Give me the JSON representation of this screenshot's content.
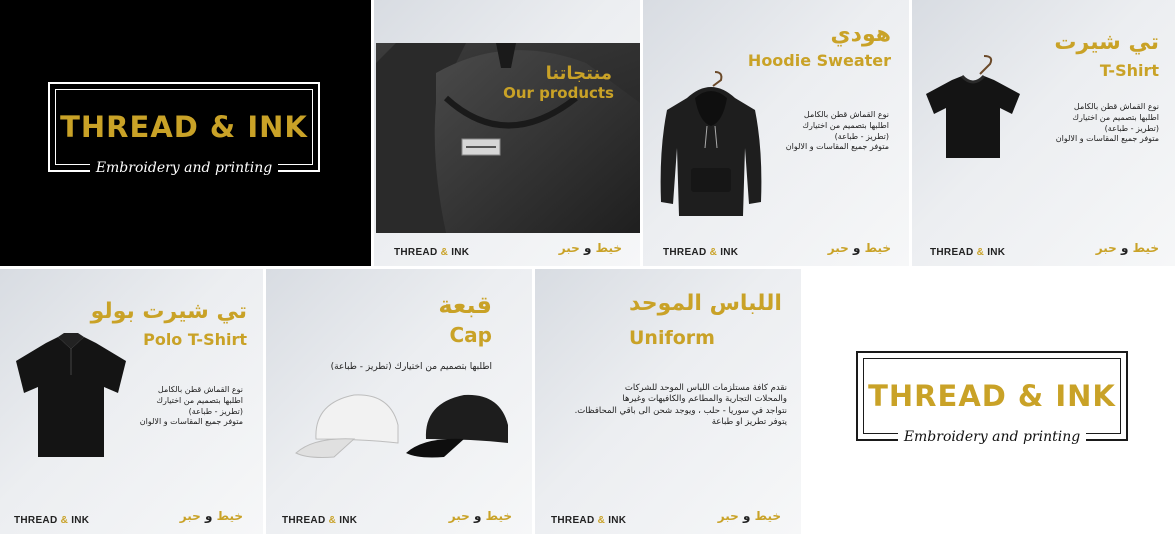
{
  "brand": {
    "name": "THREAD & INK",
    "tagline": "Embroidery and printing",
    "footer_en_left": "THREAD",
    "footer_en_amp": "&",
    "footer_en_right": "INK",
    "footer_ar_left": "خيط",
    "footer_ar_mid": "و",
    "footer_ar_right": "حبر"
  },
  "colors": {
    "gold": "#c9a227",
    "dark": "#000000",
    "tile_bg": "#e6e8eb"
  },
  "tiles": {
    "products": {
      "title_ar": "منتجاتنا",
      "title_en": "Our products",
      "tag_text": "THREAD & INK"
    },
    "hoodie": {
      "title_ar": "هودي",
      "title_en": "Hoodie Sweater",
      "lines": [
        "نوع القماش قطن بالكامل",
        "اطلبها بتصميم من اختيارك",
        "(تطريز - طباعة)",
        "متوفر جميع المقاسات و الالوان"
      ]
    },
    "tshirt": {
      "title_ar": "تي شيرت",
      "title_en": "T-Shirt",
      "lines": [
        "نوع القماش قطن بالكامل",
        "اطلبها بتصميم من اختيارك",
        "(تطريز - طباعة)",
        "متوفر جميع المقاسات و الالوان"
      ]
    },
    "polo": {
      "title_ar": "تي شيرت بولو",
      "title_en": "Polo T-Shirt",
      "lines": [
        "نوع القماش قطن بالكامل",
        "اطلبها بتصميم من اختيارك",
        "(تطريز - طباعة)",
        "متوفر جميع المقاسات و الالوان"
      ]
    },
    "cap": {
      "title_ar": "قبعة",
      "title_en": "Cap",
      "lines": [
        "اطلبها بتصميم من اختيارك (تطريز - طباعة)"
      ]
    },
    "uniform": {
      "title_ar": "اللباس الموحد",
      "title_en": "Uniform",
      "lines": [
        "نقدم كافة مستلزمات اللباس الموحد للشركات",
        "والمحلات التجارية والمطاعم والكافيهات وغيرها",
        "نتواجد في سوريا - حلب ، ويوجد شحن الى باقي المحافظات.",
        "يتوفر تطريز او طباعة"
      ]
    }
  }
}
